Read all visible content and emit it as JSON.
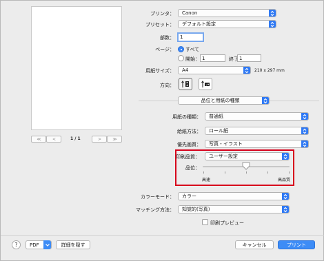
{
  "preview": {
    "page_indicator": "1 / 1",
    "first_btn": "≪",
    "prev_btn": "<",
    "next_btn": ">",
    "last_btn": "≫"
  },
  "printer": {
    "label": "プリンタ：",
    "value": "Canon"
  },
  "preset": {
    "label": "プリセット：",
    "value": "デフォルト設定"
  },
  "copies": {
    "label": "部数：",
    "value": "1"
  },
  "pages": {
    "label": "ページ：",
    "all_label": "すべて",
    "from_label": "開始：",
    "from_value": "1",
    "to_label": "終了：",
    "to_value": "1"
  },
  "paper_size": {
    "label": "用紙サイズ：",
    "value": "A4",
    "dimensions": "210 x 297 mm"
  },
  "orientation": {
    "label": "方向："
  },
  "section_popup": {
    "value": "品位と用紙の種類"
  },
  "media_type": {
    "label": "用紙の種類：",
    "value": "普通紙"
  },
  "paper_source": {
    "label": "給紙方法：",
    "value": "ロール紙"
  },
  "print_priority": {
    "label": "優先画質：",
    "value": "写真・イラスト"
  },
  "print_quality": {
    "label": "印刷品質：",
    "value": "ユーザー設定"
  },
  "quality_slider": {
    "label": "品位：",
    "min_label": "高速",
    "max_label": "高品質",
    "level_fraction": 0.5
  },
  "color_mode": {
    "label": "カラーモード：",
    "value": "カラー"
  },
  "matching": {
    "label": "マッチング方法：",
    "value": "知覚的(写真)"
  },
  "print_preview": {
    "label": "印刷プレビュー"
  },
  "footer": {
    "help": "?",
    "pdf": "PDF",
    "hide_details": "詳細を隠す",
    "cancel": "キャンセル",
    "print": "プリント"
  }
}
